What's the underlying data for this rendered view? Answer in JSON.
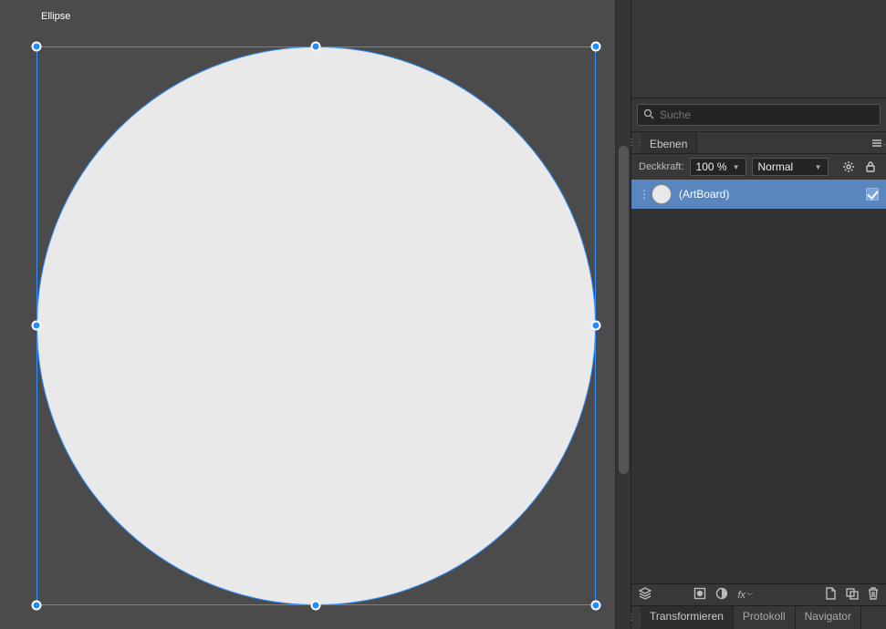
{
  "canvas": {
    "selectionLabel": "Ellipse"
  },
  "search": {
    "placeholder": "Suche"
  },
  "layersPanel": {
    "tabLabel": "Ebenen",
    "opacityLabel": "Deckkraft:",
    "opacityValue": "100 %",
    "blendMode": "Normal",
    "layers": [
      {
        "name": "(ArtBoard)"
      }
    ]
  },
  "bottomTabs": {
    "transform": "Transformieren",
    "protocol": "Protokoll",
    "navigator": "Navigator"
  }
}
